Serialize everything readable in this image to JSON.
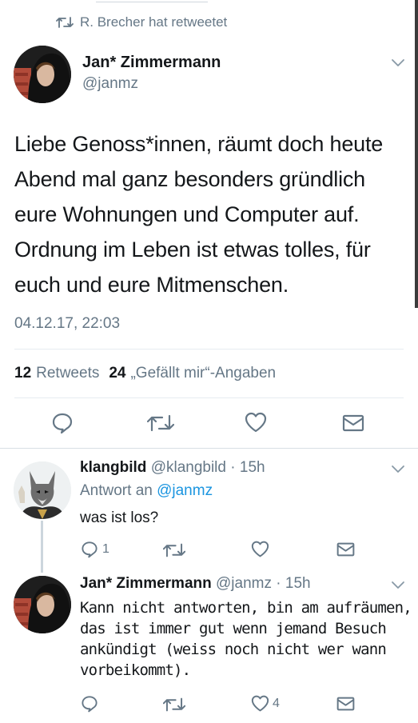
{
  "retweet_banner": {
    "text": "R. Brecher hat retweetet"
  },
  "main_tweet": {
    "author_name": "Jan* Zimmermann",
    "handle": "@janmz",
    "text_lines": [
      "Liebe Genoss*innen, räumt doch heute",
      "Abend mal ganz besonders gründlich",
      "eure Wohnungen und Computer auf.",
      "Ordnung im Leben ist etwas tolles, für",
      "euch und eure Mitmenschen."
    ],
    "timestamp": "04.12.17, 22:03",
    "retweets_count": "12",
    "retweets_label": "Retweets",
    "likes_count": "24",
    "likes_label": "„Gefällt mir“-Angaben"
  },
  "reply1": {
    "author_name": "klangbild",
    "handle": "@klangbild",
    "time": "· 15h",
    "reply_to_label": "Antwort an",
    "reply_to_handle": "@janmz",
    "text": "was ist los?",
    "reply_count": "1"
  },
  "reply2": {
    "author_name": "Jan* Zimmermann",
    "handle": "@janmz",
    "time": "· 15h",
    "text_lines": [
      "Kann nicht antworten, bin am aufräumen,",
      "das ist immer gut wenn jemand Besuch",
      "ankündigt (weiss noch nicht wer wann",
      "vorbeikommt)."
    ],
    "like_count": "4"
  },
  "colors": {
    "text": "#14171a",
    "secondary": "#657786",
    "link": "#1b95e0",
    "divider": "#e6ecf0"
  }
}
